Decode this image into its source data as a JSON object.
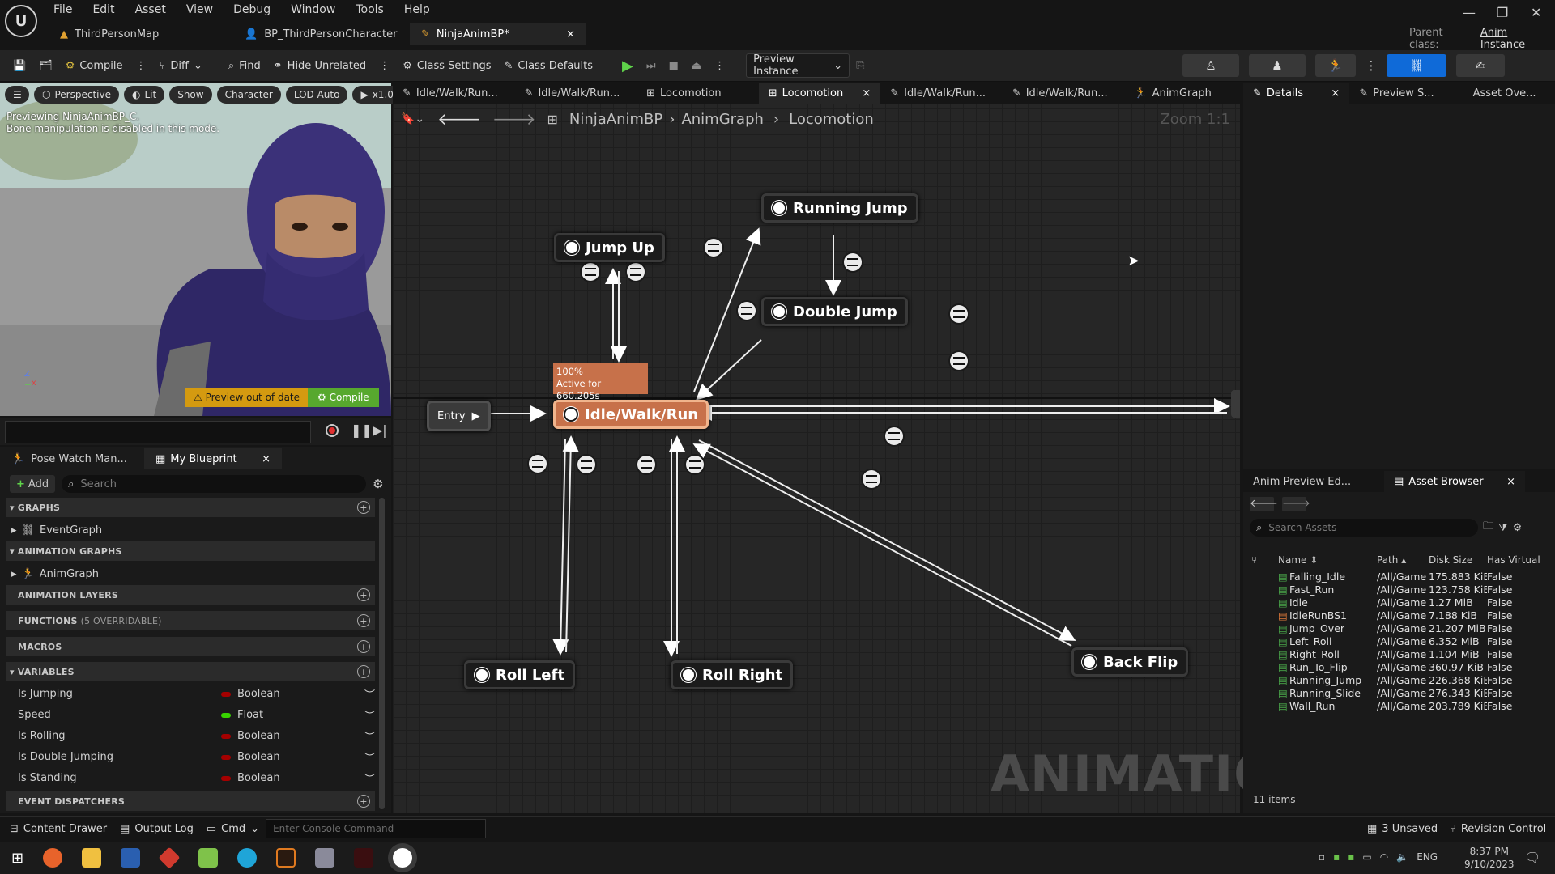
{
  "menu": [
    "File",
    "Edit",
    "Asset",
    "View",
    "Debug",
    "Window",
    "Tools",
    "Help"
  ],
  "doc_tabs": [
    {
      "label": "ThirdPersonMap"
    },
    {
      "label": "BP_ThirdPersonCharacter"
    },
    {
      "label": "NinjaAnimBP*",
      "close": "×"
    }
  ],
  "parent_class": {
    "label": "Parent class:",
    "value": "Anim Instance"
  },
  "toolbar": {
    "compile": "Compile",
    "diff": "Diff",
    "find": "Find",
    "hide_unrelated": "Hide Unrelated",
    "class_settings": "Class Settings",
    "class_defaults": "Class Defaults",
    "preview_instance": "Preview Instance"
  },
  "viewport": {
    "perspective": "Perspective",
    "lit": "Lit",
    "show": "Show",
    "character": "Character",
    "lod": "LOD Auto",
    "speed": "x1.0",
    "info_line1": "Previewing NinjaAnimBP_C.",
    "info_line2": "Bone manipulation is disabled in this mode.",
    "warn": "Preview out of date",
    "compile": "Compile"
  },
  "left_tabs": {
    "pose_watch": "Pose Watch Man...",
    "my_blueprint": "My Blueprint"
  },
  "left_panel": {
    "add": "Add",
    "search_placeholder": "Search",
    "graphs": "GRAPHS",
    "event_graph": "EventGraph",
    "animation_graphs": "ANIMATION GRAPHS",
    "anim_graph": "AnimGraph",
    "animation_layers": "ANIMATION LAYERS",
    "functions": "FUNCTIONS",
    "functions_note": "(5 OVERRIDABLE)",
    "macros": "MACROS",
    "variables": "VARIABLES",
    "event_dispatchers": "EVENT DISPATCHERS"
  },
  "variables": [
    {
      "name": "Is Jumping",
      "type": "Boolean",
      "color": "#a50000"
    },
    {
      "name": "Speed",
      "type": "Float",
      "color": "#38d400"
    },
    {
      "name": "Is Rolling",
      "type": "Boolean",
      "color": "#a50000"
    },
    {
      "name": "Is Double Jumping",
      "type": "Boolean",
      "color": "#a50000"
    },
    {
      "name": "Is Standing",
      "type": "Boolean",
      "color": "#a50000"
    }
  ],
  "graph_tabs": [
    "Idle/Walk/Run...",
    "Idle/Walk/Run...",
    "Locomotion",
    "Locomotion",
    "Idle/Walk/Run...",
    "Idle/Walk/Run...",
    "AnimGraph"
  ],
  "breadcrumb": {
    "a": "NinjaAnimBP",
    "b": "AnimGraph",
    "c": "Locomotion",
    "zoom": "Zoom 1:1"
  },
  "states": {
    "entry": "Entry",
    "idle": "Idle/Walk/Run",
    "jump_up": "Jump Up",
    "running_jump": "Running Jump",
    "double_jump": "Double Jump",
    "roll_left": "Roll Left",
    "roll_right": "Roll Right",
    "back_flip": "Back Flip"
  },
  "active_tooltip": {
    "line1": "100%",
    "line2": "Active for 660.205s"
  },
  "watermark": "ANIMATION",
  "right_tabs": {
    "details": "Details",
    "preview": "Preview S...",
    "asset_overview": "Asset Ove..."
  },
  "browser_tabs": {
    "anim_preview": "Anim Preview Ed...",
    "asset_browser": "Asset Browser"
  },
  "browser": {
    "search_placeholder": "Search Assets",
    "columns": [
      "Name",
      "Path",
      "Disk Size",
      "Has Virtual"
    ],
    "items": [
      {
        "name": "Falling_Idle",
        "path": "/All/Game",
        "size": "175.883 KiB",
        "virt": "False"
      },
      {
        "name": "Fast_Run",
        "path": "/All/Game",
        "size": "123.758 KiB",
        "virt": "False"
      },
      {
        "name": "Idle",
        "path": "/All/Game",
        "size": "1.27 MiB",
        "virt": "False"
      },
      {
        "name": "IdleRunBS1",
        "path": "/All/Game",
        "size": "7.188 KiB",
        "virt": "False"
      },
      {
        "name": "Jump_Over",
        "path": "/All/Game",
        "size": "21.207 MiB",
        "virt": "False"
      },
      {
        "name": "Left_Roll",
        "path": "/All/Game",
        "size": "6.352 MiB",
        "virt": "False"
      },
      {
        "name": "Right_Roll",
        "path": "/All/Game",
        "size": "1.104 MiB",
        "virt": "False"
      },
      {
        "name": "Run_To_Flip",
        "path": "/All/Game",
        "size": "360.97 KiB",
        "virt": "False"
      },
      {
        "name": "Running_Jump",
        "path": "/All/Game",
        "size": "226.368 KiB",
        "virt": "False"
      },
      {
        "name": "Running_Slide",
        "path": "/All/Game",
        "size": "276.343 KiB",
        "virt": "False"
      },
      {
        "name": "Wall_Run",
        "path": "/All/Game",
        "size": "203.789 KiB",
        "virt": "False"
      }
    ],
    "count": "11 items"
  },
  "statusbar": {
    "content_drawer": "Content Drawer",
    "output_log": "Output Log",
    "cmd": "Cmd",
    "console_placeholder": "Enter Console Command",
    "unsaved": "3 Unsaved",
    "revision": "Revision Control"
  },
  "taskbar": {
    "lang": "ENG",
    "time": "8:37 PM",
    "date": "9/10/2023"
  }
}
